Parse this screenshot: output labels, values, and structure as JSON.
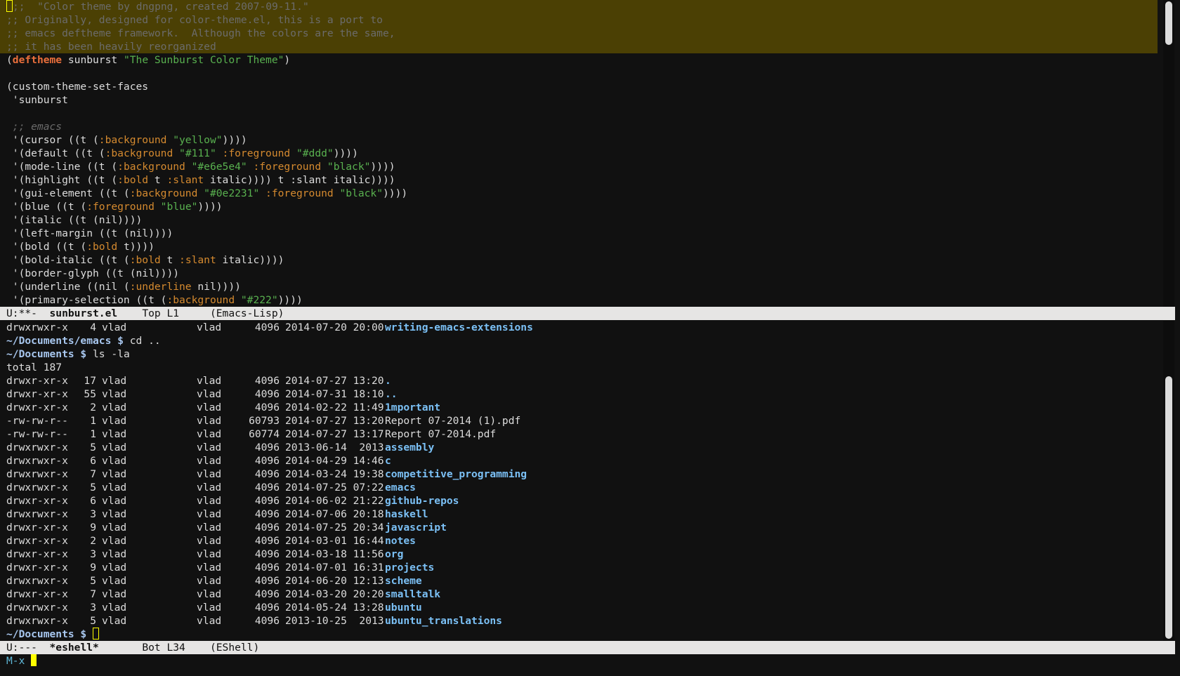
{
  "code_buffer": {
    "highlight_comments": [
      ";;  \"Color theme by dngpng, created 2007-09-11.\"",
      ";; Originally, designed for color-theme.el, this is a port to",
      ";; emacs deftheme framework.  Although the colors are the same,",
      ";; it has been heavily reorganized"
    ],
    "deftheme": {
      "open": "(",
      "keyword": "deftheme",
      "name": " sunburst ",
      "string": "\"The Sunburst Color Theme\"",
      "close": ")"
    },
    "custom_set_faces": "(custom-theme-set-faces",
    "theme_symbol": " 'sunburst",
    "section_comment": " ;; emacs",
    "faces": [
      {
        "prefix": " '(cursor ((t (",
        "k1": ":background",
        "s1": " \"yellow\"",
        "k2": "",
        "s2": "",
        "suffix": "))))"
      },
      {
        "prefix": " '(default ((t (",
        "k1": ":background",
        "s1": " \"#111\"",
        "k2": " :foreground",
        "s2": " \"#ddd\"",
        "suffix": "))))"
      },
      {
        "prefix": " '(mode-line ((t (",
        "k1": ":background",
        "s1": " \"#e6e5e4\"",
        "k2": " :foreground",
        "s2": " \"black\"",
        "suffix": "))))"
      },
      {
        "prefix": " '(highlight ((t (",
        "k1": ":bold",
        "s1": "",
        "k2": "",
        "s2": "",
        "suffix": " t :slant italic))))",
        "k_mid": " :slant",
        "mid_before": " t",
        "mid_after": " italic))))"
      },
      {
        "prefix": " '(gui-element ((t (",
        "k1": ":background",
        "s1": " \"#0e2231\"",
        "k2": " :foreground",
        "s2": " \"black\"",
        "suffix": "))))"
      },
      {
        "prefix": " '(blue ((t (",
        "k1": ":foreground",
        "s1": " \"blue\"",
        "k2": "",
        "s2": "",
        "suffix": "))))"
      },
      {
        "prefix": " '(italic ((t (nil))))",
        "k1": "",
        "s1": "",
        "k2": "",
        "s2": "",
        "suffix": ""
      },
      {
        "prefix": " '(left-margin ((t (nil))))",
        "k1": "",
        "s1": "",
        "k2": "",
        "s2": "",
        "suffix": ""
      },
      {
        "prefix": " '(bold ((t (",
        "k1": ":bold",
        "s1": "",
        "k2": "",
        "s2": "",
        "suffix": " t))))"
      },
      {
        "prefix": " '(bold-italic ((t (",
        "k1": ":bold",
        "s1": "",
        "k2": "",
        "s2": "",
        "suffix": "",
        "k_mid": " :slant",
        "mid_before": " t",
        "mid_after": " italic))))"
      },
      {
        "prefix": " '(border-glyph ((t (nil))))",
        "k1": "",
        "s1": "",
        "k2": "",
        "s2": "",
        "suffix": ""
      },
      {
        "prefix": " '(underline ((nil (",
        "k1": ":underline",
        "s1": "",
        "k2": "",
        "s2": "",
        "suffix": " nil))))"
      },
      {
        "prefix": " '(primary-selection ((t (",
        "k1": ":background",
        "s1": " \"#222\"",
        "k2": "",
        "s2": "",
        "suffix": "))))"
      }
    ]
  },
  "mode_line_code": {
    "status": "U:**-  ",
    "buffer": "sunburst.el",
    "position": "    Top L1     ",
    "mode": "(Emacs-Lisp)"
  },
  "shell_buffer": {
    "prev_entry": {
      "perm": "drwxrwxr-x",
      "links": "4",
      "user": "vlad",
      "group": "vlad",
      "size": "4096",
      "date": "2014-07-20 20:00",
      "name": "writing-emacs-extensions",
      "is_dir": true
    },
    "cmd1": {
      "prompt": "~/Documents/emacs $",
      "command": " cd .."
    },
    "cmd2": {
      "prompt": "~/Documents $",
      "command": " ls -la"
    },
    "total": "total 187",
    "entries": [
      {
        "perm": "drwxr-xr-x",
        "links": "17",
        "user": "vlad",
        "group": "vlad",
        "size": "4096",
        "date": "2014-07-27 13:20",
        "name": ".",
        "is_dir": true
      },
      {
        "perm": "drwxr-xr-x",
        "links": "55",
        "user": "vlad",
        "group": "vlad",
        "size": "4096",
        "date": "2014-07-31 18:10",
        "name": "..",
        "is_dir": true
      },
      {
        "perm": "drwxr-xr-x",
        "links": "2",
        "user": "vlad",
        "group": "vlad",
        "size": "4096",
        "date": "2014-02-22 11:49",
        "name": "1mportant",
        "is_dir": true
      },
      {
        "perm": "-rw-rw-r--",
        "links": "1",
        "user": "vlad",
        "group": "vlad",
        "size": "60793",
        "date": "2014-07-27 13:20",
        "name": "Report 07-2014 (1).pdf",
        "is_dir": false
      },
      {
        "perm": "-rw-rw-r--",
        "links": "1",
        "user": "vlad",
        "group": "vlad",
        "size": "60774",
        "date": "2014-07-27 13:17",
        "name": "Report 07-2014.pdf",
        "is_dir": false
      },
      {
        "perm": "drwxrwxr-x",
        "links": "5",
        "user": "vlad",
        "group": "vlad",
        "size": "4096",
        "date": "2013-06-14  2013",
        "name": "assembly",
        "is_dir": true
      },
      {
        "perm": "drwxrwxr-x",
        "links": "6",
        "user": "vlad",
        "group": "vlad",
        "size": "4096",
        "date": "2014-04-29 14:46",
        "name": "c",
        "is_dir": true
      },
      {
        "perm": "drwxrwxr-x",
        "links": "7",
        "user": "vlad",
        "group": "vlad",
        "size": "4096",
        "date": "2014-03-24 19:38",
        "name": "competitive_programming",
        "is_dir": true
      },
      {
        "perm": "drwxrwxr-x",
        "links": "5",
        "user": "vlad",
        "group": "vlad",
        "size": "4096",
        "date": "2014-07-25 07:22",
        "name": "emacs",
        "is_dir": true
      },
      {
        "perm": "drwxr-xr-x",
        "links": "6",
        "user": "vlad",
        "group": "vlad",
        "size": "4096",
        "date": "2014-06-02 21:22",
        "name": "github-repos",
        "is_dir": true
      },
      {
        "perm": "drwxrwxr-x",
        "links": "3",
        "user": "vlad",
        "group": "vlad",
        "size": "4096",
        "date": "2014-07-06 20:18",
        "name": "haskell",
        "is_dir": true
      },
      {
        "perm": "drwxr-xr-x",
        "links": "9",
        "user": "vlad",
        "group": "vlad",
        "size": "4096",
        "date": "2014-07-25 20:34",
        "name": "javascript",
        "is_dir": true
      },
      {
        "perm": "drwxr-xr-x",
        "links": "2",
        "user": "vlad",
        "group": "vlad",
        "size": "4096",
        "date": "2014-03-01 16:44",
        "name": "notes",
        "is_dir": true
      },
      {
        "perm": "drwxr-xr-x",
        "links": "3",
        "user": "vlad",
        "group": "vlad",
        "size": "4096",
        "date": "2014-03-18 11:56",
        "name": "org",
        "is_dir": true
      },
      {
        "perm": "drwxr-xr-x",
        "links": "9",
        "user": "vlad",
        "group": "vlad",
        "size": "4096",
        "date": "2014-07-01 16:31",
        "name": "projects",
        "is_dir": true
      },
      {
        "perm": "drwxrwxr-x",
        "links": "5",
        "user": "vlad",
        "group": "vlad",
        "size": "4096",
        "date": "2014-06-20 12:13",
        "name": "scheme",
        "is_dir": true
      },
      {
        "perm": "drwxr-xr-x",
        "links": "7",
        "user": "vlad",
        "group": "vlad",
        "size": "4096",
        "date": "2014-03-20 20:20",
        "name": "smalltalk",
        "is_dir": true
      },
      {
        "perm": "drwxrwxr-x",
        "links": "3",
        "user": "vlad",
        "group": "vlad",
        "size": "4096",
        "date": "2014-05-24 13:28",
        "name": "ubuntu",
        "is_dir": true
      },
      {
        "perm": "drwxrwxr-x",
        "links": "5",
        "user": "vlad",
        "group": "vlad",
        "size": "4096",
        "date": "2013-10-25  2013",
        "name": "ubuntu_translations",
        "is_dir": true
      }
    ],
    "final_prompt": "~/Documents $"
  },
  "mode_line_shell": {
    "status": "U:---  ",
    "buffer": "*eshell*",
    "position": "       Bot L34    ",
    "mode": "(EShell)"
  },
  "minibuffer": {
    "prompt": "M-x"
  },
  "colors": {
    "background": "#111111",
    "foreground": "#dddddd",
    "mode_line_bg": "#e6e5e4",
    "comment_highlight": "#4b4004",
    "keyword": "#ea6f3b",
    "string": "#59b14f",
    "directory": "#7bc0f5",
    "cursor": "#ffff00"
  }
}
